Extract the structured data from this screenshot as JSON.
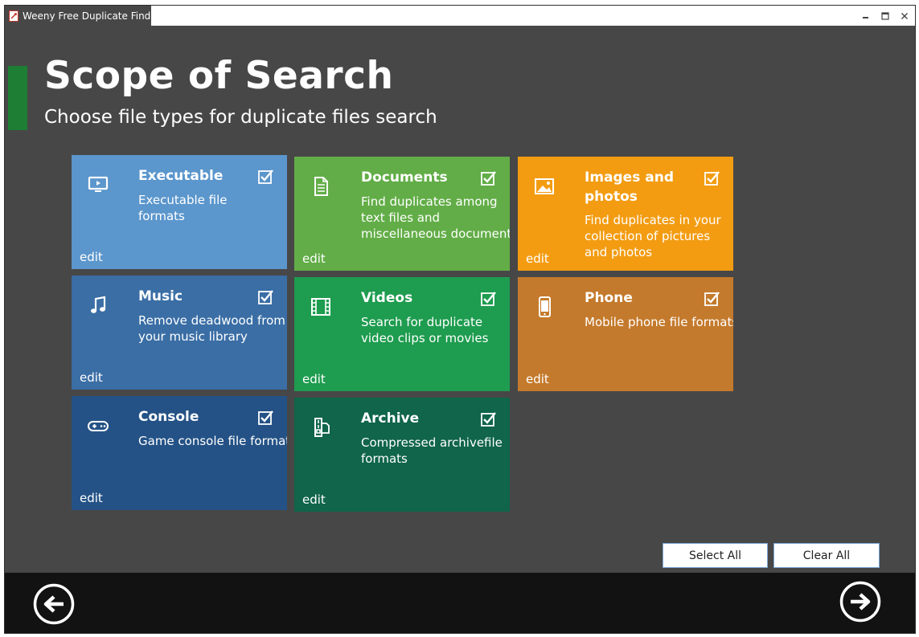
{
  "window": {
    "title": "Weeny Free Duplicate Finder",
    "app_icon": "app-logo-icon",
    "controls": [
      "minimize-icon",
      "maximize-icon",
      "close-icon"
    ]
  },
  "header": {
    "title": "Scope of Search",
    "subtitle": "Choose file types for duplicate files search",
    "accent_color": "#1e7e34"
  },
  "tiles": [
    {
      "name": "Executable",
      "desc": "Executable file formats",
      "edit": "edit",
      "icon": "monitor-icon",
      "checked": true,
      "color": "#5b96cc"
    },
    {
      "name": "Documents",
      "desc": "Find duplicates among text files and miscellaneous documents",
      "edit": "edit",
      "icon": "document-icon",
      "checked": true,
      "color": "#62ad47"
    },
    {
      "name": "Images and photos",
      "desc": "Find duplicates in your collection of pictures and photos",
      "edit": "edit",
      "icon": "picture-icon",
      "checked": true,
      "color": "#f39c12"
    },
    {
      "name": "Music",
      "desc": "Remove deadwood from your music library",
      "edit": "edit",
      "icon": "music-note-icon",
      "checked": true,
      "color": "#3a6ea5"
    },
    {
      "name": "Videos",
      "desc": "Search for duplicate video clips or movies",
      "edit": "edit",
      "icon": "film-icon",
      "checked": true,
      "color": "#1e9c4f"
    },
    {
      "name": "Phone",
      "desc": "Mobile phone file formats",
      "edit": "edit",
      "icon": "phone-icon",
      "checked": true,
      "color": "#c47a2c"
    },
    {
      "name": "Console",
      "desc": "Game console file formats",
      "edit": "edit",
      "icon": "gamepad-icon",
      "checked": true,
      "color": "#245286"
    },
    {
      "name": "Archive",
      "desc": "Compressed archivefile formats",
      "edit": "edit",
      "icon": "archive-icon",
      "checked": true,
      "color": "#10654a"
    }
  ],
  "buttons": {
    "select_all": "Select All",
    "clear_all": "Clear All"
  },
  "footer": {
    "back_icon": "arrow-left-icon",
    "next_icon": "arrow-right-icon"
  }
}
